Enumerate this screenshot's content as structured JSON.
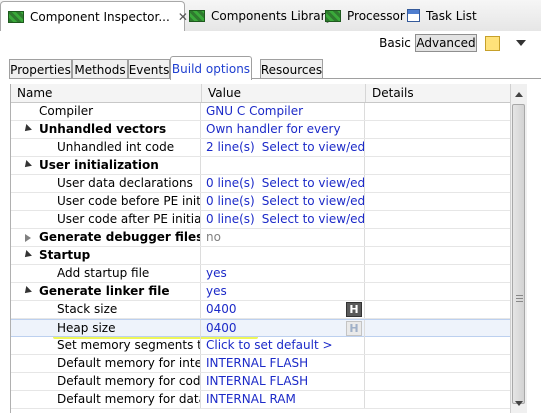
{
  "view_tabs": [
    {
      "label": "Component Inspector...",
      "icon": "component-inspector-icon",
      "active": true,
      "closable": true
    },
    {
      "label": "Components Library",
      "icon": "components-library-icon",
      "active": false
    },
    {
      "label": "Processor",
      "icon": "processor-icon",
      "active": false
    },
    {
      "label": "Task List",
      "icon": "task-list-icon",
      "active": false
    }
  ],
  "toolbar": {
    "basic_label": "Basic",
    "advanced_label": "Advanced",
    "note_icon": "note-icon",
    "menu_icon": "view-menu-icon"
  },
  "sub_tabs": [
    "Properties",
    "Methods",
    "Events",
    "Build options",
    "Resources"
  ],
  "active_sub_tab": "Build options",
  "columns": {
    "name": "Name",
    "value": "Value",
    "details": "Details"
  },
  "rows": [
    {
      "name": "Compiler",
      "value": "GNU C Compiler",
      "details": "",
      "level": 1,
      "bold": false
    },
    {
      "name": "Unhandled vectors",
      "value": "Own handler for every",
      "details": "",
      "level": 0,
      "bold": true,
      "expander": "open"
    },
    {
      "name": "Unhandled int code",
      "value": "2 line(s)",
      "value_link": "Select to view/edit",
      "details": "",
      "level": 2,
      "bold": false
    },
    {
      "name": "User initialization",
      "value": "",
      "details": "",
      "level": 0,
      "bold": true,
      "expander": "open"
    },
    {
      "name": "User data declarations",
      "value": "0 line(s)",
      "value_link": "Select to view/edit",
      "details": "",
      "level": 2,
      "bold": false
    },
    {
      "name": "User code before PE initializ",
      "value": "0 line(s)",
      "value_link": "Select to view/edit",
      "details": "",
      "level": 2,
      "bold": false
    },
    {
      "name": "User code after PE initializat",
      "value": "0 line(s)",
      "value_link": "Select to view/edit",
      "details": "",
      "level": 2,
      "bold": false
    },
    {
      "name": "Generate debugger files",
      "value": "no",
      "details": "",
      "level": 0,
      "bold": true,
      "expander": "closed",
      "gray_value": true
    },
    {
      "name": "Startup",
      "value": "",
      "details": "",
      "level": 0,
      "bold": true,
      "expander": "open"
    },
    {
      "name": "Add startup file",
      "value": "yes",
      "details": "",
      "level": 2,
      "bold": false
    },
    {
      "name": "Generate linker file",
      "value": "yes",
      "details": "",
      "level": 0,
      "bold": true,
      "expander": "open"
    },
    {
      "name": "Stack size",
      "value": "0400",
      "details": "",
      "level": 2,
      "bold": false,
      "h_button": "H",
      "h_active": true
    },
    {
      "name": "Heap size",
      "value": "0400",
      "details": "",
      "level": 2,
      "bold": false,
      "h_button": "H",
      "h_active": false,
      "selected": true
    },
    {
      "name": "Set memory segments to d",
      "value": "Click to set default >",
      "details": "",
      "level": 2,
      "bold": false
    },
    {
      "name": "Default memory for interru",
      "value": "INTERNAL FLASH",
      "details": "",
      "level": 2,
      "bold": false
    },
    {
      "name": "Default memory for code",
      "value": "INTERNAL FLASH",
      "details": "",
      "level": 2,
      "bold": false
    },
    {
      "name": "Default memory for data",
      "value": "INTERNAL RAM",
      "details": "",
      "level": 2,
      "bold": false
    }
  ],
  "colors": {
    "link": "#1c2ac8",
    "highlight": "#ebf53c",
    "active_tab_text": "#1f3fd0"
  }
}
